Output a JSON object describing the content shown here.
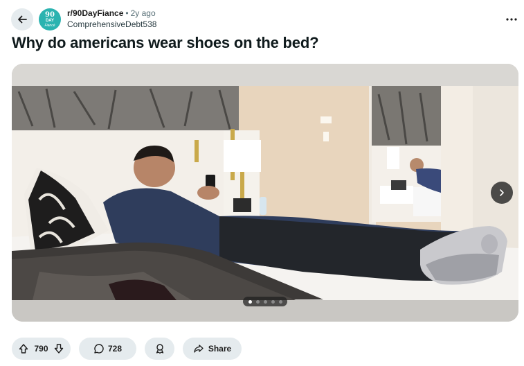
{
  "post": {
    "subreddit": "r/90DayFiance",
    "separator": "•",
    "age": "2y ago",
    "author": "ComprehensiveDebt538",
    "title": "Why do americans wear shoes on the bed?",
    "subreddit_icon": {
      "line1": "90",
      "line2": "DAY",
      "line3": "Fiancé"
    }
  },
  "gallery": {
    "image_description": "Man lying on hotel bed wearing shoes",
    "total_images": 5,
    "active_index": 0
  },
  "actions": {
    "vote_count": "790",
    "comment_count": "728",
    "share_label": "Share"
  },
  "colors": {
    "pill_bg": "#e5ebee",
    "sub_icon_bg": "#2bb3b0",
    "meta_gray": "#576f76"
  },
  "icons": [
    "back-arrow-icon",
    "more-icon",
    "chevron-right-icon",
    "upvote-icon",
    "downvote-icon",
    "comment-icon",
    "award-icon",
    "share-icon"
  ]
}
